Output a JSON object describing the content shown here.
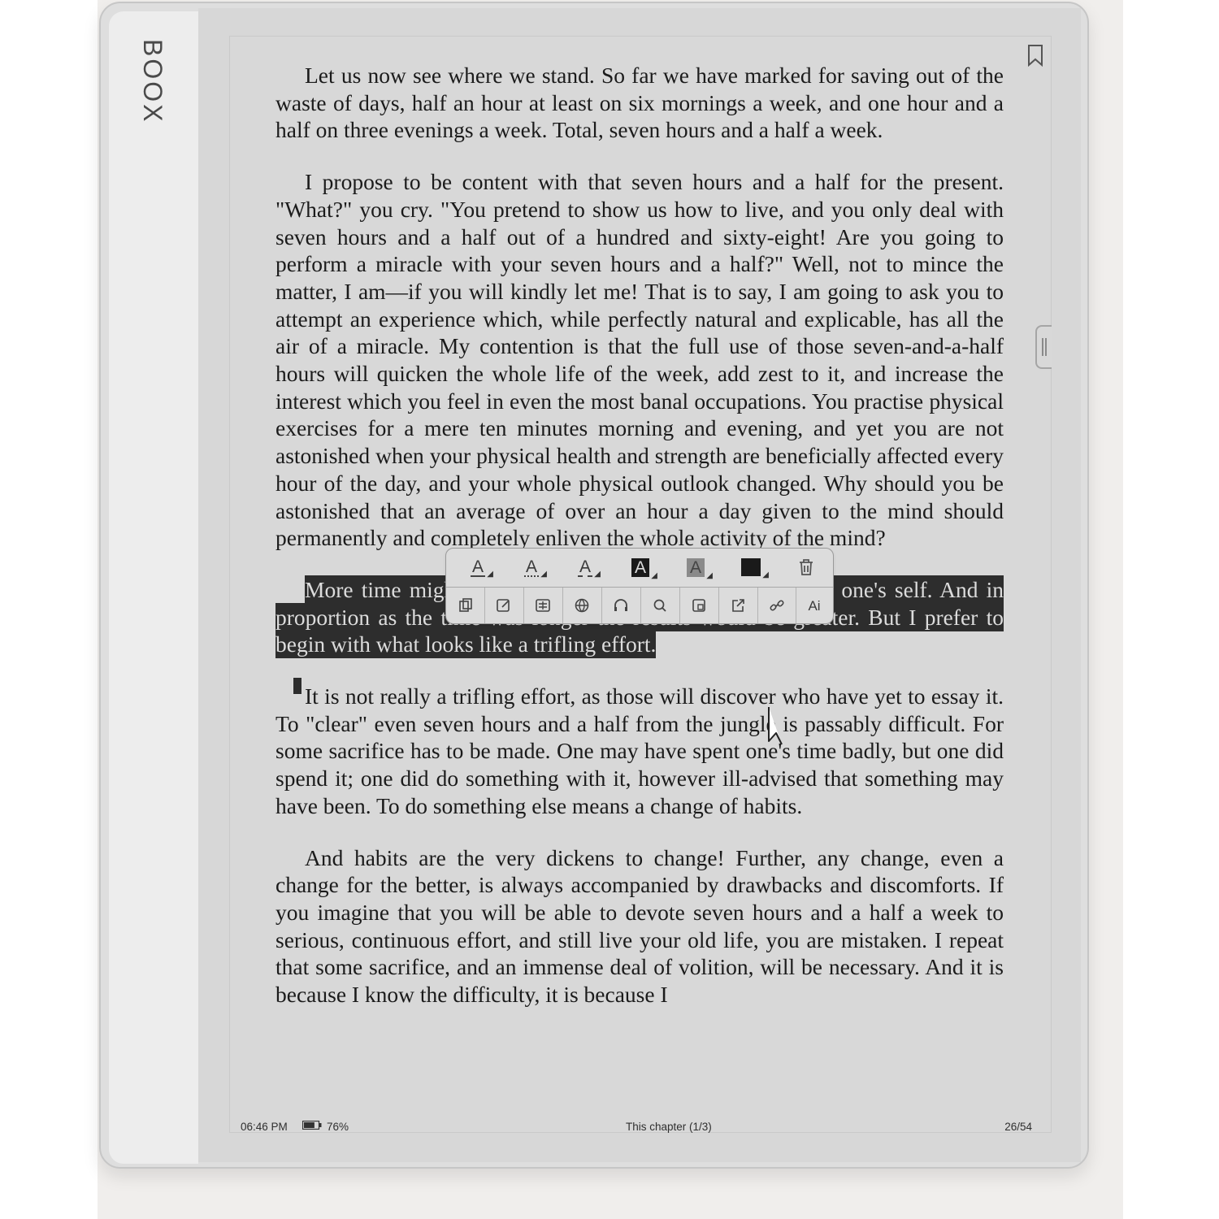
{
  "device": {
    "brand": "BOOX"
  },
  "page": {
    "paragraphs": [
      "Let us now see where we stand. So far we have marked for saving out of the waste of days, half an hour at least on six mornings a week, and one hour and a half on three evenings a week. Total, seven hours and a half a week.",
      "I propose to be content with that seven hours and a half for the present. \"What?\" you cry. \"You pretend to show us how to live, and you only deal with seven hours and a half out of a hundred and sixty-eight! Are you going to perform a miracle with your seven hours and a half?\" Well, not to mince the matter, I am—if you will kindly let me! That is to say, I am going to ask you to attempt an experience which, while perfectly natural and explicable, has all the air of a miracle. My contention is that the full use of those seven-and-a-half hours will quicken the whole life of the week, add zest to it, and increase the interest which you feel in even the most banal occupations. You practise physical exercises for a mere ten minutes morning and evening, and yet you are not astonished when your physical health and strength are beneficially affected every hour of the day, and your whole physical outlook changed. Why should you be astonished that an average of over an hour a day given to the mind should permanently and completely enliven the whole activity of the mind?",
      "More time might assuredly be given to the cultivation of one's self. And in proportion as the time was longer the results would be greater. But I prefer to begin with what looks like a trifling effort.",
      "It is not really a trifling effort, as those will discover who have yet to essay it. To \"clear\" even seven hours and a half from the jungle is passably difficult. For some sacrifice has to be made. One may have spent one's time badly, but one did spend it; one did do something with it, however ill-advised that something may have been. To do something else means a change of habits.",
      "And habits are the very dickens to change! Further, any change, even a change for the better, is always accompanied by drawbacks and discomforts. If you imagine that you will be able to devote seven hours and a half a week to serious, continuous effort, and still live your old life, you are mistaken. I repeat that some sacrifice, and an immense deal of volition, will be necessary. And it is because I know the difficulty, it is because I"
    ],
    "highlighted_paragraph_index": 2
  },
  "popup": {
    "style_buttons": [
      {
        "icon": "underline-straight-icon",
        "label": "A"
      },
      {
        "icon": "underline-wavy-icon",
        "label": "A"
      },
      {
        "icon": "underline-dashed-icon",
        "label": "A"
      },
      {
        "icon": "highlight-black-icon",
        "label": "A"
      },
      {
        "icon": "highlight-gray-icon",
        "label": "A"
      },
      {
        "icon": "fill-black-icon",
        "label": ""
      },
      {
        "icon": "trash-icon",
        "label": ""
      }
    ],
    "action_buttons": [
      {
        "icon": "copy-icon",
        "label": ""
      },
      {
        "icon": "note-icon",
        "label": ""
      },
      {
        "icon": "dictionary-icon",
        "label": ""
      },
      {
        "icon": "translate-icon",
        "label": ""
      },
      {
        "icon": "listen-icon",
        "label": ""
      },
      {
        "icon": "search-icon",
        "label": ""
      },
      {
        "icon": "excerpt-icon",
        "label": ""
      },
      {
        "icon": "share-icon",
        "label": ""
      },
      {
        "icon": "link-icon",
        "label": ""
      },
      {
        "icon": "ai-icon",
        "label": "Ai"
      }
    ]
  },
  "status_bar": {
    "time": "06:46 PM",
    "battery": "76%",
    "battery_level": 0.76,
    "chapter": "This chapter (1/3)",
    "page": "26/54"
  },
  "colors": {
    "screen": "#d8d8d8",
    "highlight": "#2d2d2d",
    "text": "#1b1b1b"
  }
}
